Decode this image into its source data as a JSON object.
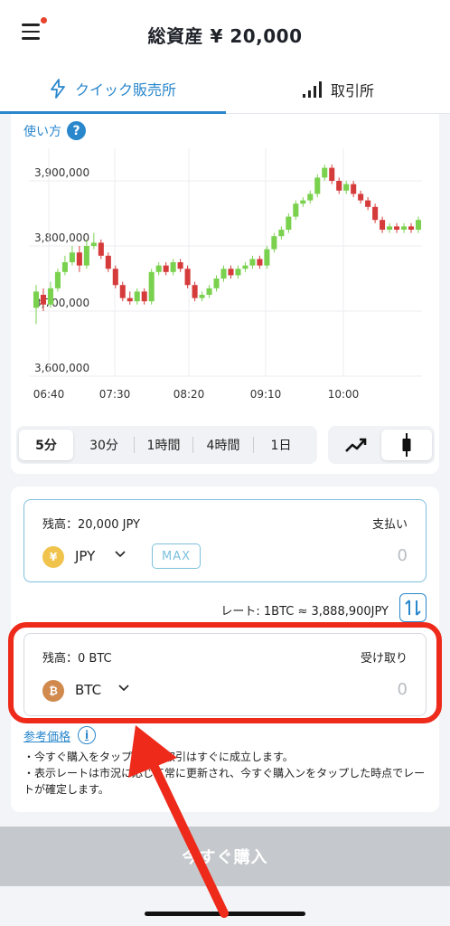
{
  "header": {
    "total_assets": "総資産 ¥ 20,000"
  },
  "tabs": [
    {
      "label": "クイック販売所",
      "icon": "lightning-icon",
      "selected": true
    },
    {
      "label": "取引所",
      "icon": "signal-bars-icon",
      "selected": false
    }
  ],
  "chart_section": {
    "howto_label": "使い方",
    "help_icon": "?",
    "timeframes": [
      "5分",
      "30分",
      "1時間",
      "4時間",
      "1日"
    ],
    "selected_timeframe": "5分",
    "chart_types": [
      "line-chart-icon",
      "candlestick-icon"
    ],
    "selected_chart_type": "candlestick-icon"
  },
  "chart_data": {
    "type": "candlestick",
    "x_ticks": [
      "06:40",
      "07:30",
      "08:20",
      "09:10",
      "10:00"
    ],
    "y_ticks": [
      "3,600,000",
      "3,700,000",
      "3,800,000",
      "3,900,000"
    ],
    "ylim": [
      3600000,
      3950000
    ],
    "up_color": "#7ad14e",
    "down_color": "#d63b3b",
    "candles": [
      [
        3705000,
        3730000,
        3680000,
        3740000
      ],
      [
        3725000,
        3710000,
        3700000,
        3735000
      ],
      [
        3710000,
        3735000,
        3705000,
        3745000
      ],
      [
        3735000,
        3760000,
        3730000,
        3765000
      ],
      [
        3760000,
        3775000,
        3755000,
        3785000
      ],
      [
        3775000,
        3790000,
        3770000,
        3800000
      ],
      [
        3790000,
        3770000,
        3760000,
        3800000
      ],
      [
        3770000,
        3800000,
        3765000,
        3810000
      ],
      [
        3800000,
        3805000,
        3795000,
        3820000
      ],
      [
        3805000,
        3785000,
        3780000,
        3810000
      ],
      [
        3785000,
        3765000,
        3760000,
        3790000
      ],
      [
        3765000,
        3740000,
        3735000,
        3770000
      ],
      [
        3740000,
        3720000,
        3715000,
        3745000
      ],
      [
        3720000,
        3715000,
        3710000,
        3730000
      ],
      [
        3715000,
        3730000,
        3710000,
        3735000
      ],
      [
        3730000,
        3715000,
        3710000,
        3735000
      ],
      [
        3715000,
        3760000,
        3710000,
        3765000
      ],
      [
        3760000,
        3770000,
        3755000,
        3775000
      ],
      [
        3770000,
        3760000,
        3755000,
        3775000
      ],
      [
        3760000,
        3775000,
        3755000,
        3780000
      ],
      [
        3775000,
        3765000,
        3760000,
        3780000
      ],
      [
        3765000,
        3740000,
        3735000,
        3770000
      ],
      [
        3740000,
        3720000,
        3715000,
        3745000
      ],
      [
        3720000,
        3725000,
        3715000,
        3730000
      ],
      [
        3725000,
        3735000,
        3720000,
        3740000
      ],
      [
        3735000,
        3750000,
        3730000,
        3755000
      ],
      [
        3750000,
        3765000,
        3745000,
        3770000
      ],
      [
        3765000,
        3755000,
        3750000,
        3770000
      ],
      [
        3755000,
        3765000,
        3750000,
        3770000
      ],
      [
        3765000,
        3770000,
        3760000,
        3775000
      ],
      [
        3770000,
        3780000,
        3765000,
        3785000
      ],
      [
        3780000,
        3770000,
        3765000,
        3785000
      ],
      [
        3770000,
        3795000,
        3765000,
        3800000
      ],
      [
        3795000,
        3815000,
        3790000,
        3820000
      ],
      [
        3815000,
        3825000,
        3810000,
        3830000
      ],
      [
        3825000,
        3845000,
        3820000,
        3850000
      ],
      [
        3845000,
        3865000,
        3840000,
        3870000
      ],
      [
        3865000,
        3870000,
        3860000,
        3875000
      ],
      [
        3870000,
        3880000,
        3865000,
        3885000
      ],
      [
        3880000,
        3905000,
        3875000,
        3910000
      ],
      [
        3905000,
        3920000,
        3900000,
        3925000
      ],
      [
        3920000,
        3900000,
        3895000,
        3925000
      ],
      [
        3900000,
        3885000,
        3880000,
        3905000
      ],
      [
        3885000,
        3895000,
        3880000,
        3900000
      ],
      [
        3895000,
        3880000,
        3875000,
        3900000
      ],
      [
        3880000,
        3870000,
        3865000,
        3885000
      ],
      [
        3870000,
        3860000,
        3855000,
        3875000
      ],
      [
        3860000,
        3840000,
        3835000,
        3865000
      ],
      [
        3840000,
        3825000,
        3820000,
        3845000
      ],
      [
        3825000,
        3830000,
        3820000,
        3835000
      ],
      [
        3830000,
        3825000,
        3820000,
        3835000
      ],
      [
        3825000,
        3830000,
        3820000,
        3835000
      ],
      [
        3830000,
        3825000,
        3820000,
        3835000
      ],
      [
        3825000,
        3840000,
        3820000,
        3845000
      ]
    ]
  },
  "pay_box": {
    "balance_label": "残高：20,000 JPY",
    "role_label": "支払い",
    "currency": "JPY",
    "currency_icon": "¥",
    "max_label": "MAX",
    "amount": "0"
  },
  "rate_text": "レート: 1BTC ≈ 3,888,900JPY",
  "receive_box": {
    "balance_label": "残高：0 BTC",
    "role_label": "受け取り",
    "currency": "BTC",
    "currency_icon": "₿",
    "amount": "0"
  },
  "reference": {
    "label": "参考価格",
    "info_icon": "i",
    "notes": [
      "・今すぐ購入をタップすると取引はすぐに成立します。",
      "・表示レートは市況に応じて常に更新され、今すぐ購入ンをタップした時点でレートが確定します。"
    ]
  },
  "buy_button": {
    "label": "今すぐ購入",
    "color": "#c5c8cc"
  },
  "annotation": {
    "highlight_color": "#ee2a1b",
    "arrow_color": "#ee2a1b"
  }
}
